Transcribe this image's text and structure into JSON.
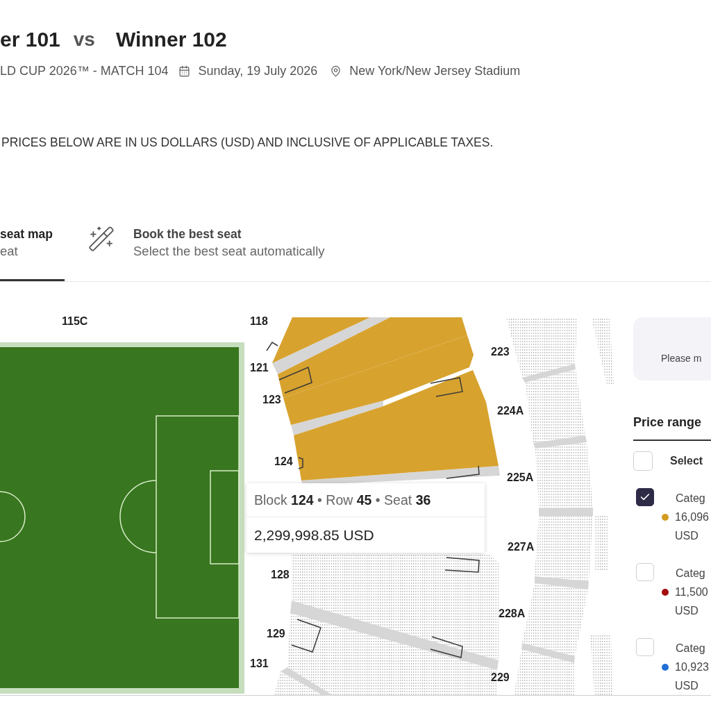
{
  "match": {
    "title": {
      "team_1": "er 101",
      "separator": "vs",
      "team_2": "Winner 102"
    },
    "competition": "LD CUP 2026™ - MATCH 104",
    "date": "Sunday, 19 July 2026",
    "venue": "New York/New Jersey Stadium"
  },
  "price_note": "PRICES BELOW ARE IN US DOLLARS (USD) AND INCLUSIVE OF APPLICABLE TAXES.",
  "tabs": [
    {
      "kind": "seat_map",
      "title": "seat map",
      "subtitle": "eat",
      "selected": true
    },
    {
      "kind": "auto_select",
      "title": "Book the best seat",
      "subtitle": "Select the best seat automatically",
      "selected": false
    }
  ],
  "seat_map": {
    "sections": [
      {
        "label": "115C"
      },
      {
        "label": "118",
        "highlighted": true
      },
      {
        "label": "121",
        "highlighted": true
      },
      {
        "label": "123",
        "highlighted": true
      },
      {
        "label": "124",
        "highlighted": true
      },
      {
        "label": "128",
        "highlighted": false
      },
      {
        "label": "129",
        "highlighted": false
      },
      {
        "label": "131",
        "highlighted": false
      },
      {
        "label": "223",
        "highlighted": false
      },
      {
        "label": "224A",
        "highlighted": false
      },
      {
        "label": "225A",
        "highlighted": false
      },
      {
        "label": "227A",
        "highlighted": false
      },
      {
        "label": "228A",
        "highlighted": false
      },
      {
        "label": "229",
        "highlighted": false
      }
    ],
    "tooltip": {
      "seat": "Block **124** • Row **45** • Seat **36**",
      "price": "2,299,998.85 USD"
    }
  },
  "info_box": {
    "text": "Please m"
  },
  "price_range": {
    "title": "Price range",
    "select_all": {
      "label": "Select",
      "checked": false
    },
    "categories": [
      {
        "name": "Categ",
        "color": "#d49b22",
        "price": "16,096",
        "currency": "USD",
        "checked": true
      },
      {
        "name": "Categ",
        "color": "#a30d0d",
        "price": "11,500",
        "currency": "USD",
        "checked": false
      },
      {
        "name": "Categ",
        "color": "#1f6fd6",
        "price": "10,923",
        "currency": "USD",
        "checked": false
      }
    ]
  }
}
